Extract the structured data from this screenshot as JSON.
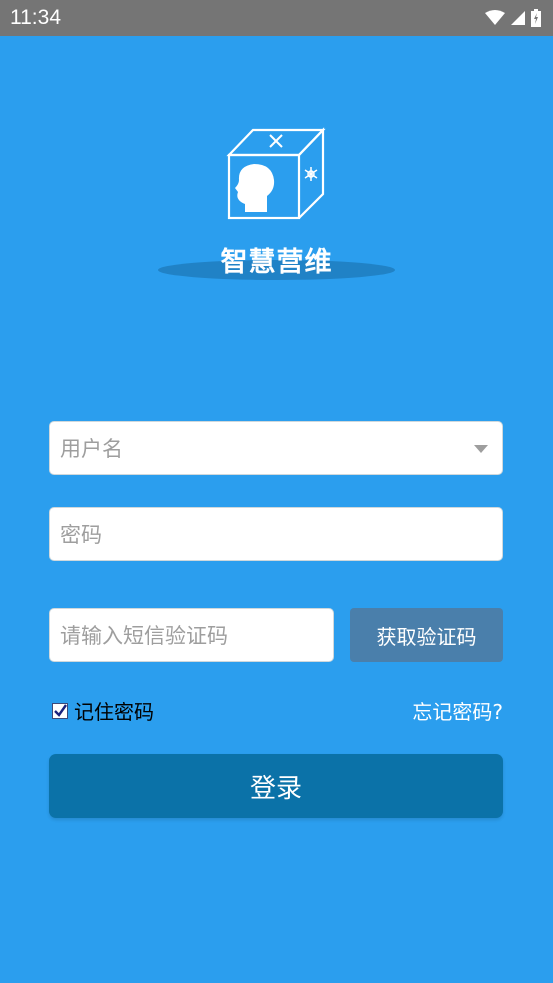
{
  "status_bar": {
    "time": "11:34",
    "icons": [
      "wifi-icon",
      "signal-icon",
      "battery-icon"
    ]
  },
  "app": {
    "title": "智慧营维",
    "logo_icon": "head-cube-logo-icon"
  },
  "form": {
    "username_placeholder": "用户名",
    "password_placeholder": "密码",
    "sms_placeholder": "请输入短信验证码",
    "get_code_label": "获取验证码",
    "remember_label": "记住密码",
    "remember_checked": true,
    "forgot_label": "忘记密码?",
    "login_label": "登录"
  },
  "colors": {
    "background": "#2b9eee",
    "status_bar": "#757575",
    "login_button": "#0b72a8",
    "get_code_button": "#4a7fab"
  }
}
